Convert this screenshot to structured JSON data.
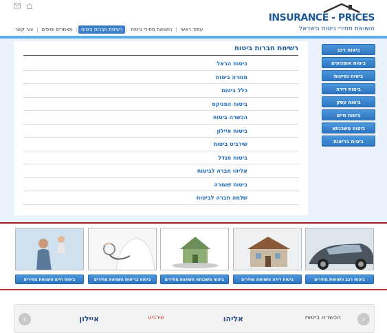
{
  "header": {
    "logo_title": "INSURANCE - PRICES",
    "logo_subtitle": "השוואת מחירי ביטוח בישראל",
    "nav": [
      "עמוד ראשי",
      "השוואת מחירי ביטוח",
      "רשימת חברות ביטוח",
      "מאמרים וטיפים",
      "צור קשר"
    ],
    "active_nav_index": 2
  },
  "sidebar": {
    "items": [
      "ביטוח רכב",
      "ביטוח אופנועים",
      "ביטוח נסיעות",
      "ביטוח דירה",
      "ביטוח עסק",
      "ביטוח חיים",
      "ביטוח משכנתא",
      "ביטוח בריאות"
    ]
  },
  "main": {
    "title": "רשימת חברות ביטוח",
    "companies": [
      "ביטוח הראל",
      "מנורה ביטוח",
      "כלל ביטוח",
      "ביטוח הפניקס",
      "הכשרה ביטוח",
      "ביטוח איילון",
      "שירביט ביטוח",
      "ביטוח מגדל",
      "אליהו חברה לביטוח",
      "ביטוח שומרה",
      "שלמה חברה לביטוח"
    ]
  },
  "cards": [
    {
      "label": "ביטוח רכב השוואת מחירים",
      "image": "car"
    },
    {
      "label": "ביטוח דירה השוואת מחירים",
      "image": "house-construction"
    },
    {
      "label": "ביטוח משכנתא השוואת מחירים",
      "image": "money-house"
    },
    {
      "label": "ביטוח בריאות השוואת מחירים",
      "image": "doctor-stethoscope"
    },
    {
      "label": "ביטוח חיים השוואת מחירים",
      "image": "family"
    }
  ],
  "partners": {
    "logos": [
      "הכשרה ביטוח",
      "אליהו",
      "שירביט",
      "איילון"
    ]
  },
  "colors": {
    "brand_blue": "#1c5a99",
    "button_blue": "#3a86d0",
    "accent_red": "#a02020",
    "content_bg": "#eaf3fb"
  }
}
